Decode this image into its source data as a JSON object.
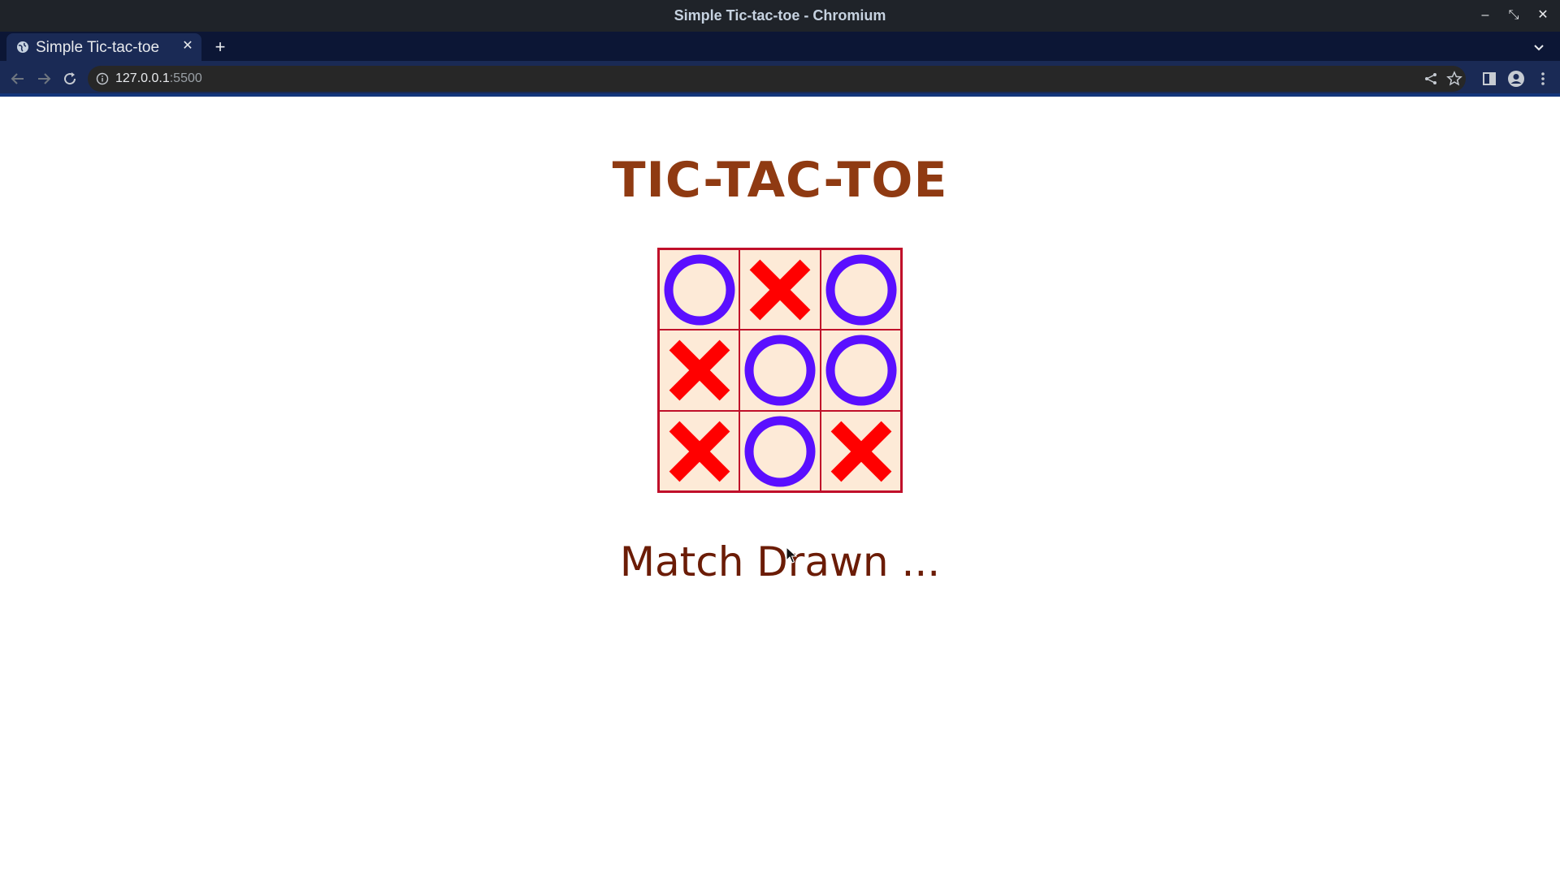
{
  "window": {
    "title": "Simple Tic-tac-toe - Chromium"
  },
  "tabs": [
    {
      "label": "Simple Tic-tac-toe",
      "favicon": "globe-icon"
    }
  ],
  "address_bar": {
    "host": "127.0.0.1",
    "port": ":5500"
  },
  "page": {
    "heading": "TIC-TAC-TOE",
    "status": "Match Drawn ...",
    "board": [
      [
        "O",
        "X",
        "O"
      ],
      [
        "X",
        "O",
        "O"
      ],
      [
        "X",
        "O",
        "X"
      ]
    ],
    "colors": {
      "x": "#ff0000",
      "o": "#5a0fff",
      "cell_bg": "#fdead7",
      "grid": "#c00f2a",
      "heading": "#8f3a12",
      "status": "#6b1c06"
    }
  }
}
